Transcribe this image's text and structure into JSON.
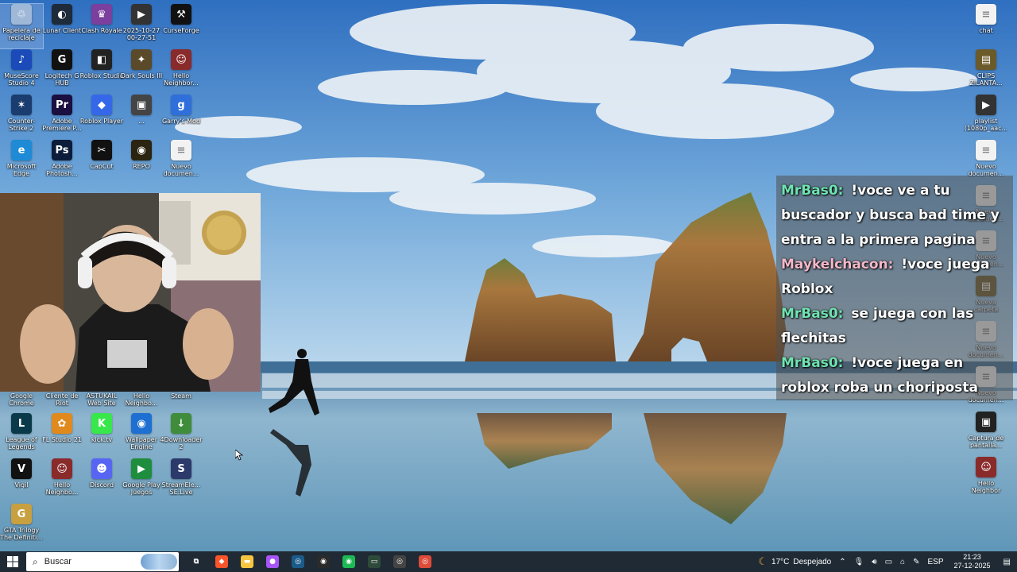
{
  "desktop_icons_left": [
    {
      "label": "Papelera de reciclaje",
      "icon": "recycle-bin-icon",
      "color": "#9fb8d8",
      "glyph": "♲"
    },
    {
      "label": "Lunar Client",
      "icon": "lunar-client-icon",
      "color": "#1e2b3a",
      "glyph": "◐"
    },
    {
      "label": "Clash Royale",
      "icon": "clash-royale-icon",
      "color": "#7b3f9e",
      "glyph": "♛"
    },
    {
      "label": "2025-10-27 00-27-51",
      "icon": "video-file-icon",
      "color": "#333333",
      "glyph": "▶"
    },
    {
      "label": "CurseForge",
      "icon": "curseforge-icon",
      "color": "#111111",
      "glyph": "⚒"
    },
    {
      "label": "MuseScore Studio 4",
      "icon": "musescore-icon",
      "color": "#1a4bb8",
      "glyph": "♪"
    },
    {
      "label": "Logitech G HUB",
      "icon": "logitech-icon",
      "color": "#111111",
      "glyph": "G"
    },
    {
      "label": "Roblox Studio",
      "icon": "roblox-studio-icon",
      "color": "#222222",
      "glyph": "◧"
    },
    {
      "label": "Dark Souls III",
      "icon": "dark-souls-icon",
      "color": "#5a4a2a",
      "glyph": "✦"
    },
    {
      "label": "Hello Neighbor...",
      "icon": "hello-neighbor-icon",
      "color": "#8a2b2b",
      "glyph": "☺"
    },
    {
      "label": "Counter-Strike 2",
      "icon": "counter-strike-icon",
      "color": "#1a3c6e",
      "glyph": "✶"
    },
    {
      "label": "Adobe Premiere P...",
      "icon": "premiere-icon",
      "color": "#1b0e40",
      "glyph": "Pr"
    },
    {
      "label": "Roblox Player",
      "icon": "roblox-player-icon",
      "color": "#3568e8",
      "glyph": "◆"
    },
    {
      "label": "...",
      "icon": "image-file-icon",
      "color": "#444444",
      "glyph": "▣"
    },
    {
      "label": "Garry's Mod",
      "icon": "garrys-mod-icon",
      "color": "#2f6fdb",
      "glyph": "g"
    },
    {
      "label": "Microsoft Edge",
      "icon": "edge-icon",
      "color": "#1f8bd6",
      "glyph": "e"
    },
    {
      "label": "Adobe Photosh...",
      "icon": "photoshop-icon",
      "color": "#0b1d3a",
      "glyph": "Ps"
    },
    {
      "label": "CapCut",
      "icon": "capcut-icon",
      "color": "#111111",
      "glyph": "✂"
    },
    {
      "label": "REPO",
      "icon": "repo-game-icon",
      "color": "#2a2410",
      "glyph": "◉"
    },
    {
      "label": "Nuevo documen...",
      "icon": "text-document-icon",
      "color": "#f2f2f2",
      "glyph": "≡"
    },
    {
      "label": "Google Chrome",
      "icon": "chrome-icon",
      "color": "#dd4b39",
      "glyph": "◎"
    },
    {
      "label": "Cliente de Riot",
      "icon": "riot-client-icon",
      "color": "#d13639",
      "glyph": "R"
    },
    {
      "label": "ASTUKAIL Web Site",
      "icon": "web-shortcut-icon",
      "color": "#2b5aa0",
      "glyph": "◍"
    },
    {
      "label": "Hello Neighbo...",
      "icon": "hello-neighbor-icon",
      "color": "#8a2b2b",
      "glyph": "☺"
    },
    {
      "label": "Steam",
      "icon": "steam-icon",
      "color": "#1b2838",
      "glyph": "◎"
    },
    {
      "label": "League of Legends",
      "icon": "league-icon",
      "color": "#0a3a4a",
      "glyph": "L"
    },
    {
      "label": "FL Studio 21",
      "icon": "fl-studio-icon",
      "color": "#e08a1e",
      "glyph": "✿"
    },
    {
      "label": "kick.tv",
      "icon": "kick-icon",
      "color": "#38e84a",
      "glyph": "K"
    },
    {
      "label": "Wallpaper Engine",
      "icon": "wallpaper-engine-icon",
      "color": "#1d6fd1",
      "glyph": "◉"
    },
    {
      "label": "4Downloader 2",
      "icon": "downloader-icon",
      "color": "#3f8d3a",
      "glyph": "↓"
    },
    {
      "label": "Vigil",
      "icon": "vigil-icon",
      "color": "#111111",
      "glyph": "V"
    },
    {
      "label": "Hello Neighbo...",
      "icon": "hello-neighbor-icon",
      "color": "#8a2b2b",
      "glyph": "☺"
    },
    {
      "label": "Discord",
      "icon": "discord-icon",
      "color": "#5865f2",
      "glyph": "☻"
    },
    {
      "label": "Google Play Juegos",
      "icon": "play-games-icon",
      "color": "#1e8e3e",
      "glyph": "▶"
    },
    {
      "label": "StreamEle... SE.Live",
      "icon": "streamelements-icon",
      "color": "#2b3a6a",
      "glyph": "S"
    },
    {
      "label": "GTA Trilogy The Definiti...",
      "icon": "gta-icon",
      "color": "#c8a040",
      "glyph": "G"
    }
  ],
  "desktop_icons_right": [
    {
      "label": "chat",
      "icon": "text-document-icon",
      "color": "#f2f2f2",
      "glyph": "≡"
    },
    {
      "label": "CLIPS ZILANTA...",
      "icon": "folder-icon",
      "color": "#6b5a2a",
      "glyph": "▤"
    },
    {
      "label": "playlist (1080p_aac...",
      "icon": "video-file-icon",
      "color": "#333333",
      "glyph": "▶"
    },
    {
      "label": "Nuevo documen...",
      "icon": "text-document-icon",
      "color": "#f2f2f2",
      "glyph": "≡"
    },
    {
      "label": "Nuevo documen...",
      "icon": "text-document-icon",
      "color": "#f2f2f2",
      "glyph": "≡"
    },
    {
      "label": "Nuevo documen...",
      "icon": "text-document-icon",
      "color": "#f2f2f2",
      "glyph": "≡"
    },
    {
      "label": "Nueva carpeta",
      "icon": "folder-icon",
      "color": "#6b5a2a",
      "glyph": "▤"
    },
    {
      "label": "Nuevo documen...",
      "icon": "text-document-icon",
      "color": "#f2f2f2",
      "glyph": "≡"
    },
    {
      "label": "Nuevo documen...",
      "icon": "text-document-icon",
      "color": "#f2f2f2",
      "glyph": "≡"
    },
    {
      "label": "Captura de pantalla...",
      "icon": "image-file-icon",
      "color": "#222222",
      "glyph": "▣"
    },
    {
      "label": "Hello Neighbor",
      "icon": "hello-neighbor-icon",
      "color": "#8a2b2b",
      "glyph": "☺"
    }
  ],
  "chat": {
    "messages": [
      {
        "user": "MrBas0",
        "text": "!voce ve a tu buscador y busca bad time y entra a la primera pagina",
        "color": "#6fe3b1"
      },
      {
        "user": "Maykelchacon",
        "text": "!voce juega Roblox",
        "color": "#f4b8c8"
      },
      {
        "user": "MrBas0",
        "text": "se juega con las flechitas",
        "color": "#6fe3b1"
      },
      {
        "user": "MrBas0",
        "text": "!voce juega en roblox roba un choriposta",
        "color": "#6fe3b1"
      }
    ]
  },
  "taskbar": {
    "search_placeholder": "Buscar",
    "apps": [
      {
        "name": "task-view-icon",
        "glyph": "⧉",
        "color": "#1f2a34"
      },
      {
        "name": "brave-icon",
        "glyph": "◆",
        "color": "#fb542b"
      },
      {
        "name": "file-explorer-icon",
        "glyph": "▬",
        "color": "#f5c542"
      },
      {
        "name": "messenger-icon",
        "glyph": "●",
        "color": "#a855f7"
      },
      {
        "name": "steam-icon",
        "glyph": "◎",
        "color": "#1b5b8a"
      },
      {
        "name": "obs-icon",
        "glyph": "◉",
        "color": "#2b2b2b"
      },
      {
        "name": "spotify-icon",
        "glyph": "◉",
        "color": "#1db954"
      },
      {
        "name": "game-overlay-icon",
        "glyph": "▭",
        "color": "#2e4a3a"
      },
      {
        "name": "obs-studio-icon",
        "glyph": "◎",
        "color": "#444444"
      },
      {
        "name": "chrome-icon",
        "glyph": "◎",
        "color": "#dd4b39"
      }
    ],
    "weather": {
      "temp": "17°C",
      "condition": "Despejado"
    },
    "language": "ESP",
    "time": "21:23",
    "date": "27-12-2025"
  }
}
